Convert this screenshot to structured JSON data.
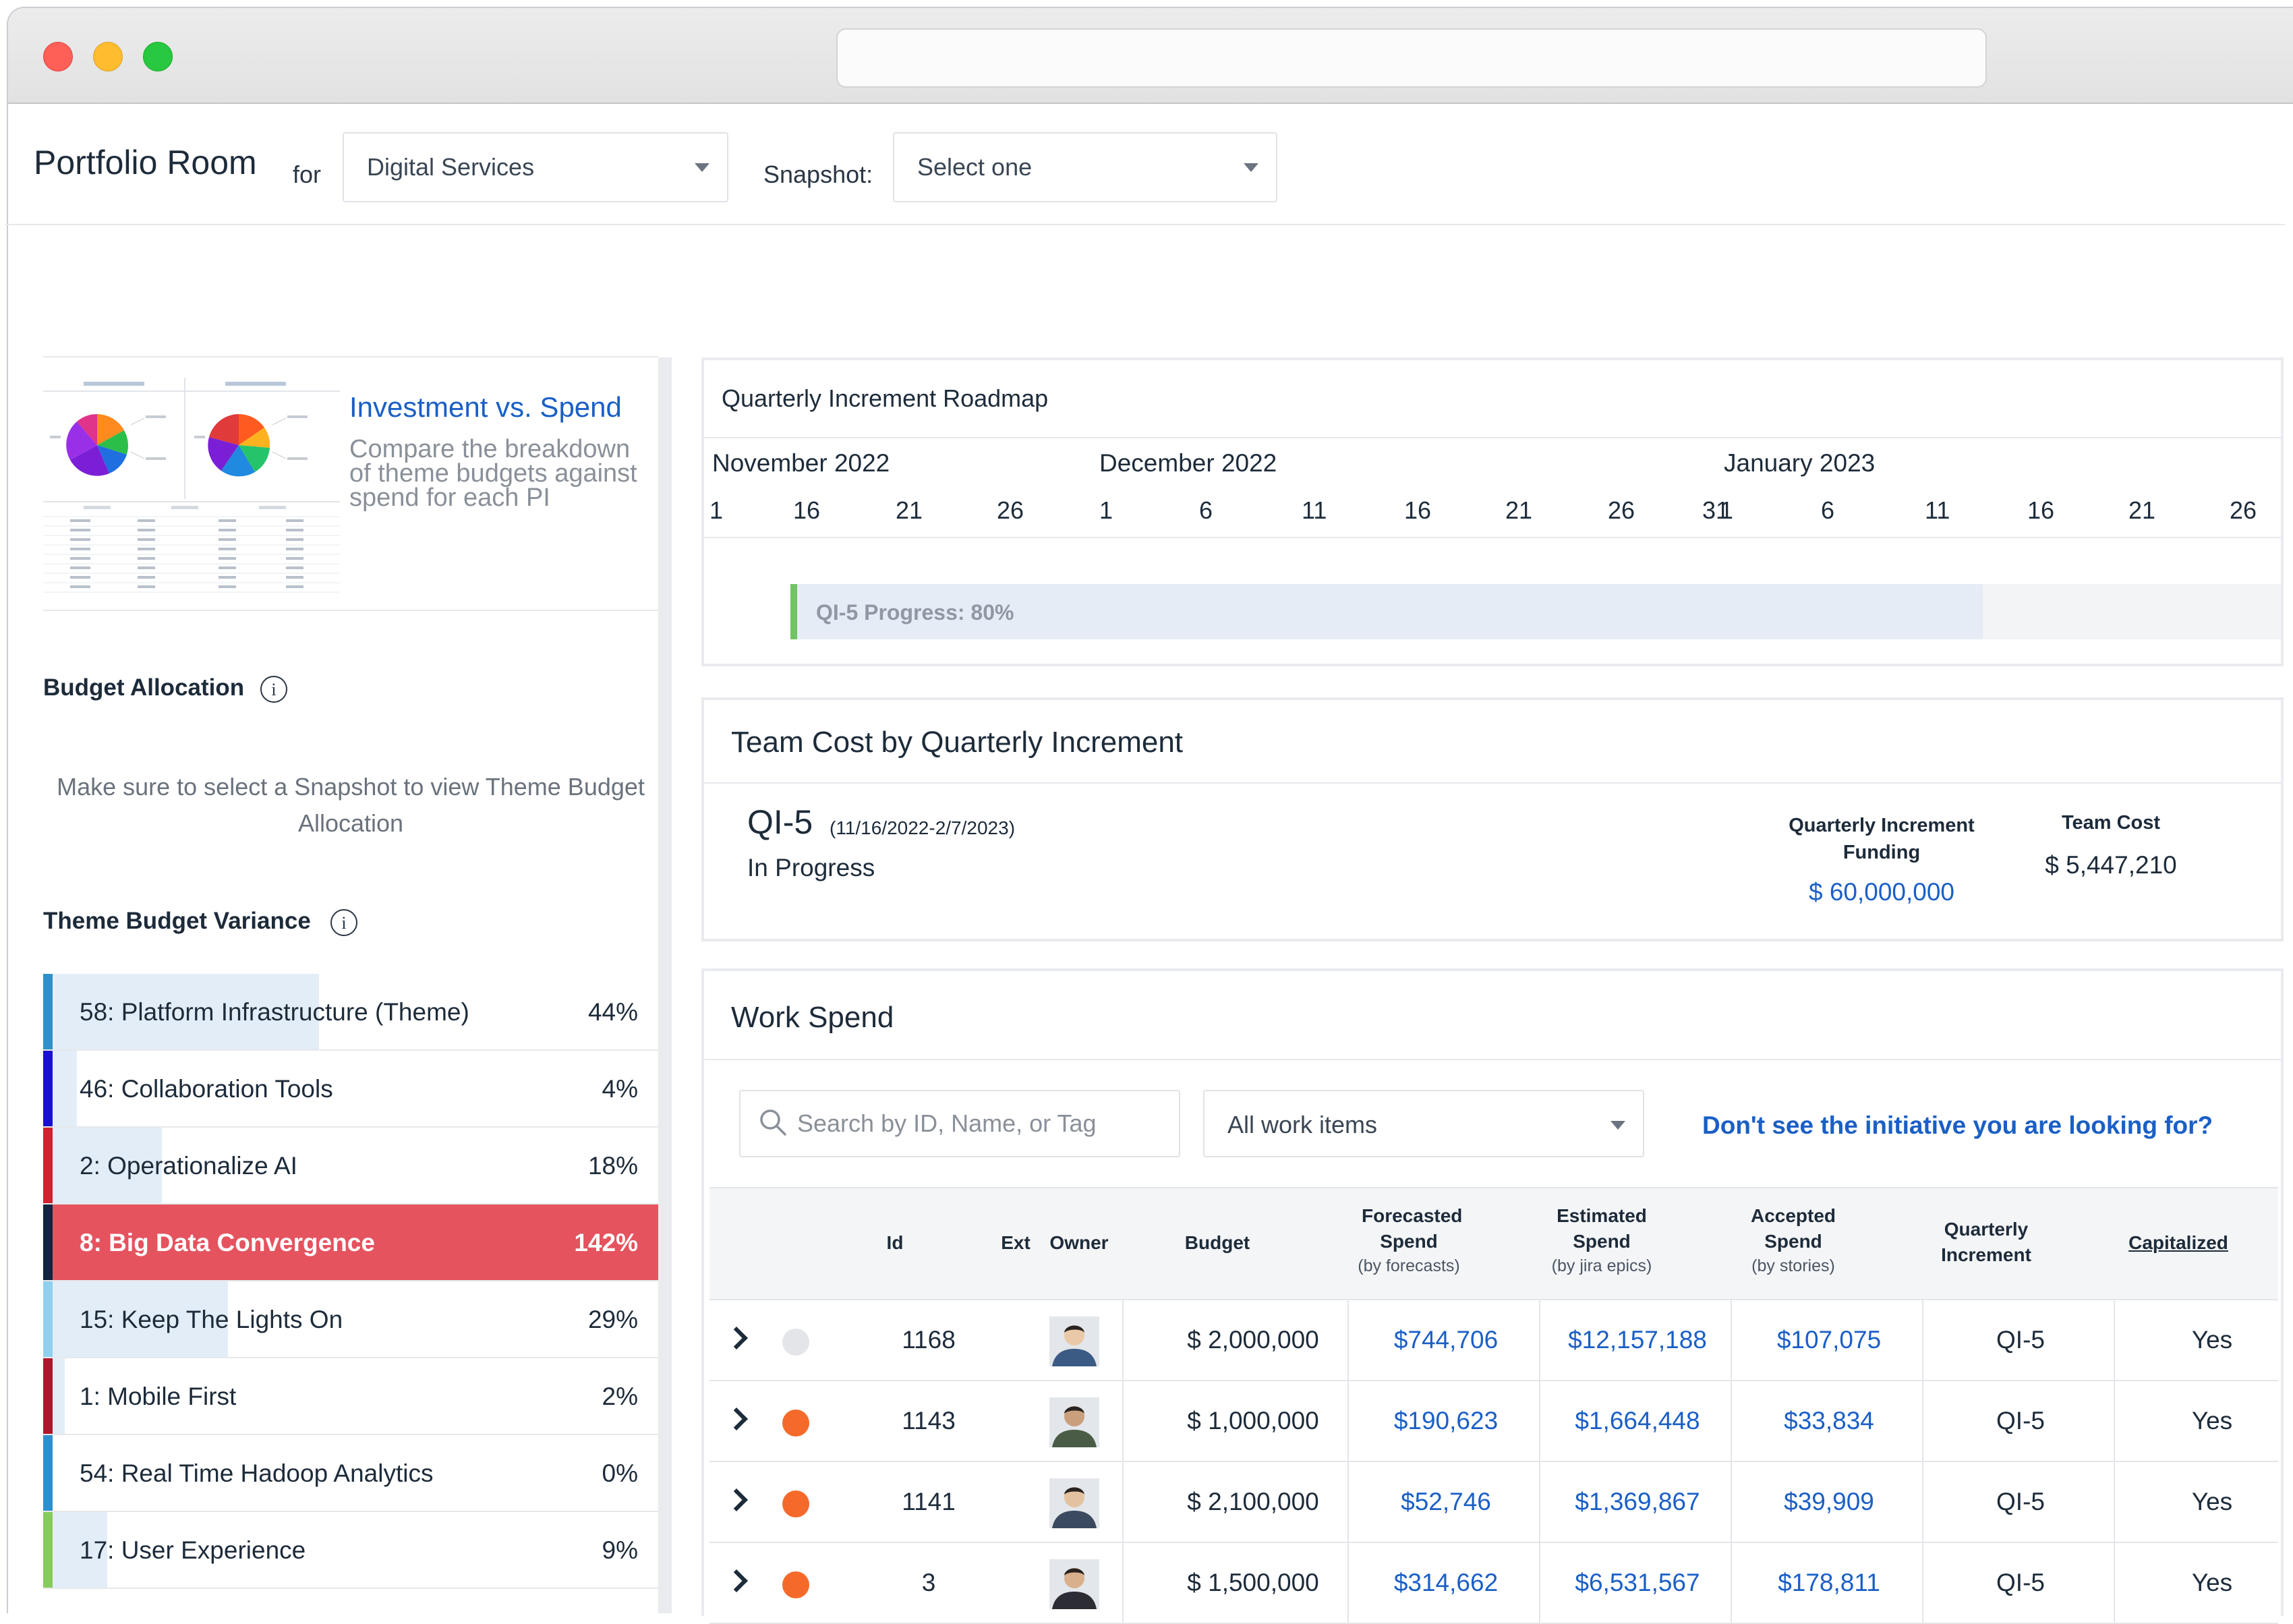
{
  "header": {
    "title": "Portfolio Room",
    "for_label": "for",
    "portfolio_value": "Digital Services",
    "snapshot_label": "Snapshot:",
    "snapshot_placeholder": "Select one"
  },
  "promo": {
    "title": "Investment vs. Spend",
    "description": "Compare the breakdown of theme budgets against spend for each PI"
  },
  "budget_allocation": {
    "label": "Budget Allocation",
    "note": "Make sure to select a Snapshot to view Theme Budget Allocation"
  },
  "theme_variance": {
    "label": "Theme Budget Variance",
    "items": [
      {
        "name": "58: Platform Infrastructure (Theme)",
        "pct_label": "44%",
        "value": 44,
        "color": "#2f8fcb"
      },
      {
        "name": "46: Collaboration Tools",
        "pct_label": "4%",
        "value": 4,
        "color": "#1a0fd6"
      },
      {
        "name": "2: Operationalize AI",
        "pct_label": "18%",
        "value": 18,
        "color": "#d61f2f"
      },
      {
        "name": "8: Big Data Convergence",
        "pct_label": "142%",
        "value": 142,
        "color": "#0f2540",
        "over": true
      },
      {
        "name": "15: Keep The Lights On",
        "pct_label": "29%",
        "value": 29,
        "color": "#8fd0ef"
      },
      {
        "name": "1: Mobile First",
        "pct_label": "2%",
        "value": 2,
        "color": "#b0162b"
      },
      {
        "name": "54: Real Time Hadoop Analytics",
        "pct_label": "0%",
        "value": 0,
        "color": "#2d8fd0"
      },
      {
        "name": "17: User Experience",
        "pct_label": "9%",
        "value": 9,
        "color": "#86cc5a"
      }
    ]
  },
  "roadmap": {
    "title": "Quarterly Increment Roadmap",
    "months": [
      "November 2022",
      "December 2022",
      "January 2023"
    ],
    "days": [
      "1",
      "16",
      "21",
      "26",
      "1",
      "6",
      "11",
      "16",
      "21",
      "26",
      "31",
      "1",
      "6",
      "11",
      "16",
      "21",
      "26"
    ],
    "progress_label": "QI-5 Progress: 80%",
    "progress": 0.8
  },
  "team_cost": {
    "title": "Team Cost by Quarterly Increment",
    "qi_name": "QI-5",
    "qi_range": "(11/16/2022-2/7/2023)",
    "status": "In Progress",
    "funding_label": "Quarterly Increment Funding",
    "funding_value": "$ 60,000,000",
    "cost_label": "Team Cost",
    "cost_value": "$ 5,447,210"
  },
  "work_spend": {
    "title": "Work Spend",
    "search_placeholder": "Search by ID, Name, or Tag",
    "filter_value": "All work items",
    "missing_link": "Don't see the initiative you are looking for?",
    "columns": {
      "id": "Id",
      "ext": "Ext",
      "owner": "Owner",
      "budget": "Budget",
      "forecasted": "Forecasted Spend",
      "forecasted_sub": "(by forecasts)",
      "estimated": "Estimated Spend",
      "estimated_sub": "(by jira epics)",
      "accepted": "Accepted Spend",
      "accepted_sub": "(by stories)",
      "qi": "Quarterly Increment",
      "capitalized": "Capitalized"
    },
    "rows": [
      {
        "status_color": "#e3e5e8",
        "id": "1168",
        "budget": "$ 2,000,000",
        "forecasted": "$744,706",
        "estimated": "$12,157,188",
        "accepted": "$107,075",
        "qi": "QI-5",
        "capitalized": "Yes"
      },
      {
        "status_color": "#f56a2a",
        "id": "1143",
        "budget": "$ 1,000,000",
        "forecasted": "$190,623",
        "estimated": "$1,664,448",
        "accepted": "$33,834",
        "qi": "QI-5",
        "capitalized": "Yes"
      },
      {
        "status_color": "#f56a2a",
        "id": "1141",
        "budget": "$ 2,100,000",
        "forecasted": "$52,746",
        "estimated": "$1,369,867",
        "accepted": "$39,909",
        "qi": "QI-5",
        "capitalized": "Yes"
      },
      {
        "status_color": "#f56a2a",
        "id": "3",
        "budget": "$ 1,500,000",
        "forecasted": "$314,662",
        "estimated": "$6,531,567",
        "accepted": "$178,811",
        "qi": "QI-5",
        "capitalized": "Yes"
      }
    ]
  }
}
